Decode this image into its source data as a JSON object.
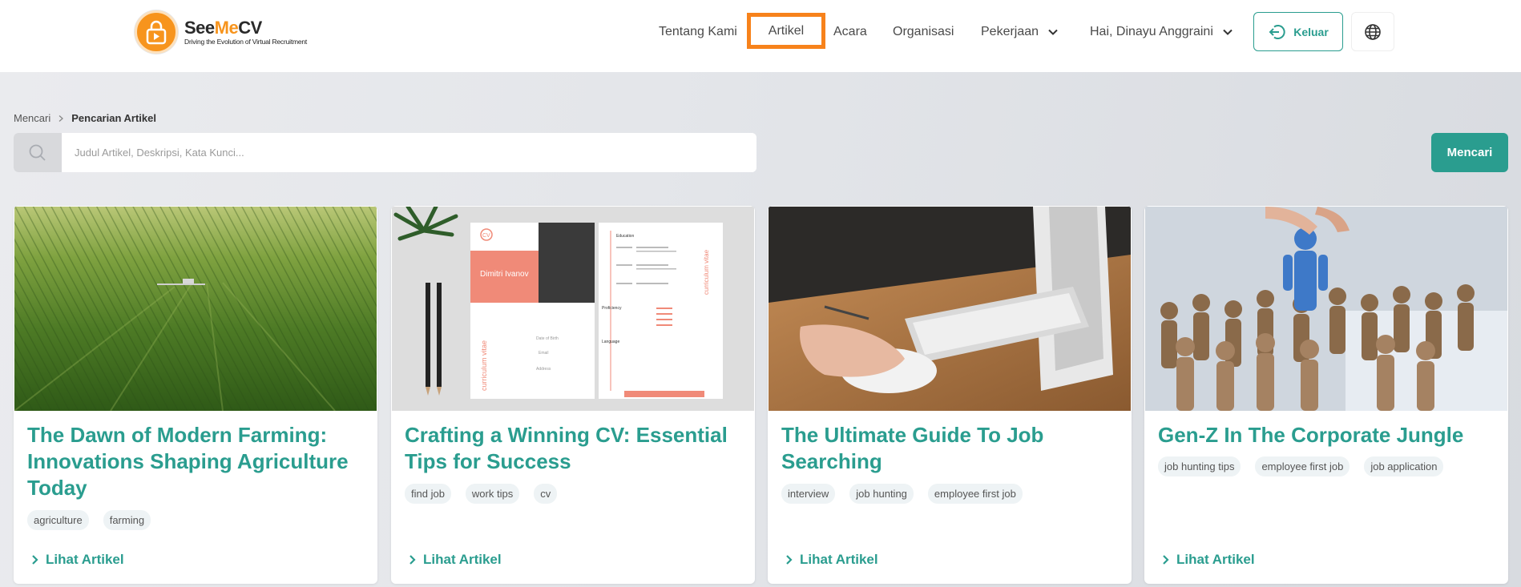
{
  "brand": {
    "name_part1": "See",
    "name_part2": "Me",
    "name_part3": "CV",
    "tagline": "Driving the Evolution of Virtual Recruitment"
  },
  "nav": {
    "about": "Tentang Kami",
    "articles": "Artikel",
    "events": "Acara",
    "organizations": "Organisasi",
    "jobs": "Pekerjaan",
    "user_greeting": "Hai, Dinayu Anggraini",
    "logout": "Keluar"
  },
  "breadcrumb": {
    "root": "Mencari",
    "current": "Pencarian Artikel"
  },
  "search": {
    "placeholder": "Judul Artikel, Deskripsi, Kata Kunci...",
    "value": "",
    "button": "Mencari"
  },
  "articles": [
    {
      "title": "The Dawn of Modern Farming: Innovations Shaping Agriculture Today",
      "tags": [
        "agriculture",
        "farming"
      ],
      "link": "Lihat Artikel"
    },
    {
      "title": "Crafting a Winning CV: Essential Tips for Success",
      "tags": [
        "find job",
        "work tips",
        "cv"
      ],
      "link": "Lihat Artikel",
      "image_text": {
        "cv": "CV",
        "name": "Dimitri Ivanov",
        "vertical": "curriculum vitae",
        "education": "Education",
        "proficiency": "Proficiency",
        "language": "Language",
        "dob": "Date of Birth",
        "email": "Email",
        "address": "Address"
      }
    },
    {
      "title": "The Ultimate Guide To Job Searching",
      "tags": [
        "interview",
        "job hunting",
        "employee first job"
      ],
      "link": "Lihat Artikel"
    },
    {
      "title": "Gen-Z In The Corporate Jungle",
      "tags": [
        "job hunting tips",
        "employee first job",
        "job application"
      ],
      "link": "Lihat Artikel"
    }
  ],
  "colors": {
    "accent": "#2a9d8f",
    "brand_orange": "#f7941d",
    "highlight": "#f7821b"
  }
}
